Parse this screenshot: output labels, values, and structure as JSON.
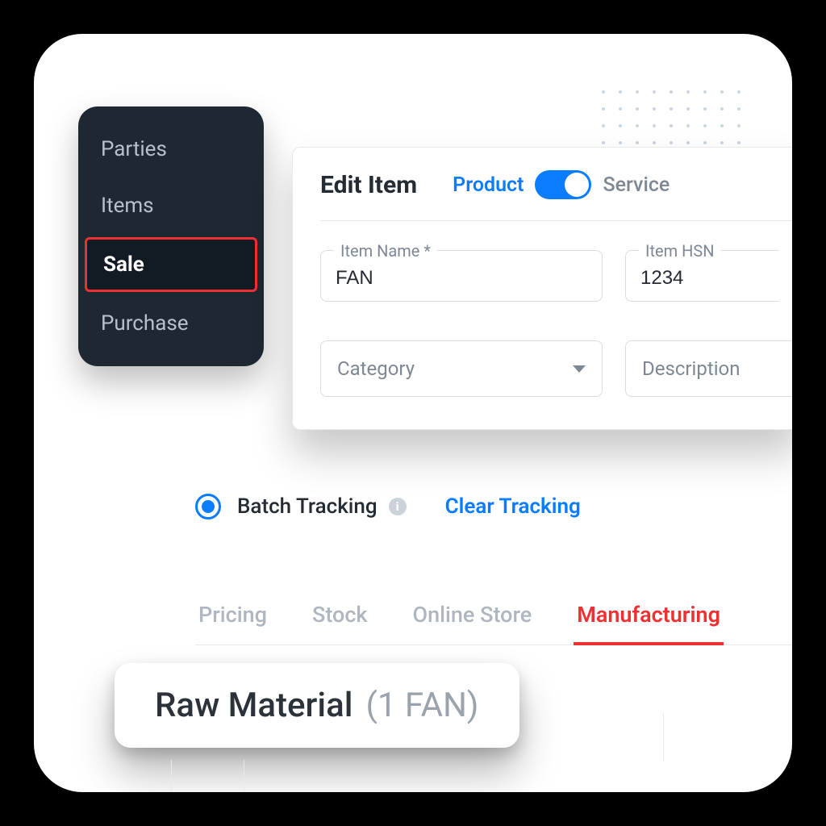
{
  "sidebar": {
    "items": [
      {
        "label": "Parties"
      },
      {
        "label": "Items"
      },
      {
        "label": "Sale"
      },
      {
        "label": "Purchase"
      }
    ],
    "active_index": 2
  },
  "card": {
    "title": "Edit Item",
    "toggle": {
      "on_label": "Product",
      "off_label": "Service"
    },
    "item_name": {
      "label": "Item Name *",
      "value": "FAN"
    },
    "item_hsn": {
      "label": "Item HSN",
      "value": "1234"
    },
    "category": {
      "placeholder": "Category"
    },
    "description": {
      "placeholder": "Description"
    }
  },
  "tracking": {
    "batch_label": "Batch Tracking",
    "clear_label": "Clear Tracking"
  },
  "tabs": {
    "items": [
      {
        "label": "Pricing"
      },
      {
        "label": "Stock"
      },
      {
        "label": "Online Store"
      },
      {
        "label": "Manufacturing"
      }
    ],
    "active_index": 3
  },
  "pill": {
    "main": "Raw Material",
    "sub": "(1 FAN)"
  }
}
